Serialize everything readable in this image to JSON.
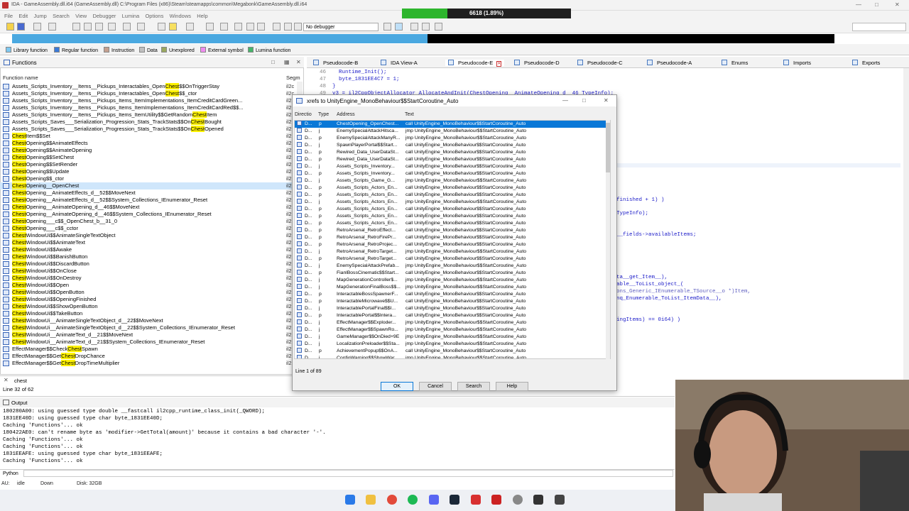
{
  "window": {
    "title": "IDA - GameAssembly.dll.i64 (GameAssembly.dll) C:\\Program Files (x86)\\Steam\\steamapps\\common\\Megabonk\\GameAssembly.dll.i64",
    "progress_text": "6618 (1.89%)",
    "progress_fraction": 0.27
  },
  "menu": [
    "File",
    "Edit",
    "Jump",
    "Search",
    "View",
    "Debugger",
    "Lumina",
    "Options",
    "Windows",
    "Help"
  ],
  "toolbar": {
    "debugger_select": "No debugger"
  },
  "legend": [
    {
      "label": "Library function",
      "color": "#7ec8f0"
    },
    {
      "label": "Regular function",
      "color": "#3a7ad8"
    },
    {
      "label": "Instruction",
      "color": "#c4a090"
    },
    {
      "label": "Data",
      "color": "#c0c0c0"
    },
    {
      "label": "Unexplored",
      "color": "#9aa860"
    },
    {
      "label": "External symbol",
      "color": "#f08cf0"
    },
    {
      "label": "Lumina function",
      "color": "#46b46a"
    }
  ],
  "functions": {
    "title": "Functions",
    "col_name": "Function name",
    "col_seg": "Segm",
    "rows": [
      {
        "pre": "Assets_Scripts_Inventory__Items__Pickups_Interactables_Open",
        "hl": "Chest",
        "post": "$$OnTriggerStay",
        "seg": "il2c"
      },
      {
        "pre": "Assets_Scripts_Inventory__Items__Pickups_Interactables_Open",
        "hl": "Chest",
        "post": "$$_ctor",
        "seg": "il2c"
      },
      {
        "pre": "Assets_Scripts_Inventory__Items__Pickups_Items_ItemImplementations_ItemCreditCardGreen...",
        "hl": "",
        "post": "",
        "seg": "il2"
      },
      {
        "pre": "Assets_Scripts_Inventory__Items__Pickups_Items_ItemImplementations_ItemCreditCardRed$$...",
        "hl": "",
        "post": "",
        "seg": "il2"
      },
      {
        "pre": "Assets_Scripts_Inventory__Items__Pickups_Items_ItemUtility$$GetRandom",
        "hl": "Chest",
        "post": "Item",
        "seg": "il2"
      },
      {
        "pre": "Assets_Scripts_Saves___Serialization_Progression_Stats_TrackStats$$On",
        "hl": "Chest",
        "post": "Bought",
        "seg": "il2"
      },
      {
        "pre": "Assets_Scripts_Saves___Serialization_Progression_Stats_TrackStats$$On",
        "hl": "Chest",
        "post": "Opened",
        "seg": "il2"
      },
      {
        "pre": "",
        "hl": "Chest",
        "post": "Item$$Set",
        "seg": "il2"
      },
      {
        "pre": "",
        "hl": "Chest",
        "post": "Opening$$AnimateEffects",
        "seg": "il2"
      },
      {
        "pre": "",
        "hl": "Chest",
        "post": "Opening$$AnimateOpening",
        "seg": "il2"
      },
      {
        "pre": "",
        "hl": "Chest",
        "post": "Opening$$SetChest",
        "seg": "il2"
      },
      {
        "pre": "",
        "hl": "Chest",
        "post": "Opening$$SetRender",
        "seg": "il2"
      },
      {
        "pre": "",
        "hl": "Chest",
        "post": "Opening$$Update",
        "seg": "il2"
      },
      {
        "pre": "",
        "hl": "Chest",
        "post": "Opening$$_ctor",
        "seg": "il2"
      },
      {
        "pre": "",
        "hl": "Chest",
        "post": "Opening__OpenChest",
        "seg": "il2"
      },
      {
        "pre": "",
        "hl": "Chest",
        "post": "Opening__AnimateEffects_d__52$$MoveNext",
        "seg": "il2"
      },
      {
        "pre": "",
        "hl": "Chest",
        "post": "Opening__AnimateEffects_d__52$$System_Collections_IEnumerator_Reset",
        "seg": "il2"
      },
      {
        "pre": "",
        "hl": "Chest",
        "post": "Opening__AnimateOpening_d__46$$MoveNext",
        "seg": "il2"
      },
      {
        "pre": "",
        "hl": "Chest",
        "post": "Opening__AnimateOpening_d__46$$System_Collections_IEnumerator_Reset",
        "seg": "il2"
      },
      {
        "pre": "",
        "hl": "Chest",
        "post": "Opening___c$$_OpenChest_b__31_0",
        "seg": "il2"
      },
      {
        "pre": "",
        "hl": "Chest",
        "post": "Opening___c$$_cctor",
        "seg": "il2"
      },
      {
        "pre": "",
        "hl": "Chest",
        "post": "WindowUi$$AnimateSingleTextObject",
        "seg": "il2"
      },
      {
        "pre": "",
        "hl": "Chest",
        "post": "WindowUi$$AnimateText",
        "seg": "il2"
      },
      {
        "pre": "",
        "hl": "Chest",
        "post": "WindowUi$$Awake",
        "seg": "il2"
      },
      {
        "pre": "",
        "hl": "Chest",
        "post": "WindowUi$$BanishButton",
        "seg": "il2"
      },
      {
        "pre": "",
        "hl": "Chest",
        "post": "WindowUi$$DiscardButton",
        "seg": "il2"
      },
      {
        "pre": "",
        "hl": "Chest",
        "post": "WindowUi$$OnClose",
        "seg": "il2"
      },
      {
        "pre": "",
        "hl": "Chest",
        "post": "WindowUi$$OnDestroy",
        "seg": "il2"
      },
      {
        "pre": "",
        "hl": "Chest",
        "post": "WindowUi$$Open",
        "seg": "il2"
      },
      {
        "pre": "",
        "hl": "Chest",
        "post": "WindowUi$$OpenButton",
        "seg": "il2"
      },
      {
        "pre": "",
        "hl": "Chest",
        "post": "WindowUi$$OpeningFinished",
        "seg": "il2"
      },
      {
        "pre": "",
        "hl": "Chest",
        "post": "WindowUi$$ShowOpenButton",
        "seg": "il2"
      },
      {
        "pre": "",
        "hl": "Chest",
        "post": "WindowUi$$TakeButton",
        "seg": "il2"
      },
      {
        "pre": "",
        "hl": "Chest",
        "post": "WindowUi__AnimateSingleTextObject_d__22$$MoveNext",
        "seg": "il2"
      },
      {
        "pre": "",
        "hl": "Chest",
        "post": "WindowUi__AnimateSingleTextObject_d__22$$System_Collections_IEnumerator_Reset",
        "seg": "il2"
      },
      {
        "pre": "",
        "hl": "Chest",
        "post": "WindowUi__AnimateText_d__21$$MoveNext",
        "seg": "il2"
      },
      {
        "pre": "",
        "hl": "Chest",
        "post": "WindowUi__AnimateText_d__21$$System_Collections_IEnumerator_Reset",
        "seg": "il2"
      },
      {
        "pre": "EffectManager$$Check",
        "hl": "Chest",
        "post": "Spawn",
        "seg": "il2"
      },
      {
        "pre": "EffectManager$$Get",
        "hl": "Chest",
        "post": "DropChance",
        "seg": "il2"
      },
      {
        "pre": "EffectManager$$Get",
        "hl": "Chest",
        "post": "DropTimeMultiplier",
        "seg": "il2"
      }
    ],
    "selected_index": 14,
    "search_value": "chest",
    "line_info": "Line 32 of 62"
  },
  "tabs": [
    {
      "label": "Pseudocode-B",
      "active": false
    },
    {
      "label": "IDA View-A",
      "active": false
    },
    {
      "label": "Pseudocode-E",
      "active": true
    },
    {
      "label": "Pseudocode-D",
      "active": false
    },
    {
      "label": "Pseudocode-C",
      "active": false
    },
    {
      "label": "Pseudocode-A",
      "active": false
    },
    {
      "label": "Enums",
      "active": false
    },
    {
      "label": "Imports",
      "active": false
    },
    {
      "label": "Exports",
      "active": false
    }
  ],
  "code": {
    "lines": [
      {
        "n": "46",
        "t": "    Runtime_Init();"
      },
      {
        "n": "47",
        "t": "    byte_1831EE4C7 = 1;"
      },
      {
        "n": "48",
        "t": "  }"
      },
      {
        "n": "49",
        "t": "  v3 = il2CppObjectAllocator_AllocateAndInit(ChestOpening__AnimateOpening_d__46_TypeInfo);"
      }
    ],
    "fragments": [
      "finished + 1) )",
      "TypeInfo);",
      "__fields->availableItems;",
      "ta__get_Item__),",
      "able__ToList_object_(",
      "ons_Generic_IEnumerable_TSource__o *)Item,",
      "nq_Enumerable_ToList_ItemData__),",
      "ingItems) == 0i64) )"
    ]
  },
  "xrefs": {
    "title": "xrefs to UnityEngine_MonoBehaviour$$StartCoroutine_Auto",
    "headers": {
      "dir": "Directio",
      "type": "Type",
      "addr": "Address",
      "text": "Text"
    },
    "rows": [
      {
        "d": "D...",
        "t": "p",
        "a": "ChestOpening_OpenChest...",
        "x": "call   UnityEngine_MonoBehaviour$$StartCoroutine_Auto"
      },
      {
        "d": "D...",
        "t": "j",
        "a": "EnemySpecialAttackHitsca...",
        "x": "jmp    UnityEngine_MonoBehaviour$$StartCoroutine_Auto"
      },
      {
        "d": "D...",
        "t": "p",
        "a": "EnemySpecialAttackManyR...",
        "x": "jmp    UnityEngine_MonoBehaviour$$StartCoroutine_Auto"
      },
      {
        "d": "D...",
        "t": "j",
        "a": "SpawnPlayerPortal$$Start...",
        "x": "call   UnityEngine_MonoBehaviour$$StartCoroutine_Auto"
      },
      {
        "d": "D...",
        "t": "p",
        "a": "Rewired_Data_UserDataSt...",
        "x": "call   UnityEngine_MonoBehaviour$$StartCoroutine_Auto"
      },
      {
        "d": "D...",
        "t": "p",
        "a": "Rewired_Data_UserDataSt...",
        "x": "call   UnityEngine_MonoBehaviour$$StartCoroutine_Auto"
      },
      {
        "d": "D...",
        "t": "j",
        "a": "Assets_Scripts_Inventory...",
        "x": "call   UnityEngine_MonoBehaviour$$StartCoroutine_Auto"
      },
      {
        "d": "D...",
        "t": "p",
        "a": "Assets_Scripts_Inventory...",
        "x": "call   UnityEngine_MonoBehaviour$$StartCoroutine_Auto"
      },
      {
        "d": "D...",
        "t": "j",
        "a": "Assets_Scripts_Game_G...",
        "x": "jmp    UnityEngine_MonoBehaviour$$StartCoroutine_Auto"
      },
      {
        "d": "D...",
        "t": "p",
        "a": "Assets_Scripts_Actors_En...",
        "x": "call   UnityEngine_MonoBehaviour$$StartCoroutine_Auto"
      },
      {
        "d": "D...",
        "t": "p",
        "a": "Assets_Scripts_Actors_En...",
        "x": "call   UnityEngine_MonoBehaviour$$StartCoroutine_Auto"
      },
      {
        "d": "D...",
        "t": "j",
        "a": "Assets_Scripts_Actors_En...",
        "x": "jmp    UnityEngine_MonoBehaviour$$StartCoroutine_Auto"
      },
      {
        "d": "D...",
        "t": "p",
        "a": "Assets_Scripts_Actors_En...",
        "x": "call   UnityEngine_MonoBehaviour$$StartCoroutine_Auto"
      },
      {
        "d": "D...",
        "t": "p",
        "a": "Assets_Scripts_Actors_En...",
        "x": "call   UnityEngine_MonoBehaviour$$StartCoroutine_Auto"
      },
      {
        "d": "D...",
        "t": "p",
        "a": "Assets_Scripts_Actors_En...",
        "x": "call   UnityEngine_MonoBehaviour$$StartCoroutine_Auto"
      },
      {
        "d": "D...",
        "t": "p",
        "a": "RetroArsenal_RetroEffect...",
        "x": "call   UnityEngine_MonoBehaviour$$StartCoroutine_Auto"
      },
      {
        "d": "D...",
        "t": "p",
        "a": "RetroArsenal_RetroFirePr...",
        "x": "call   UnityEngine_MonoBehaviour$$StartCoroutine_Auto"
      },
      {
        "d": "D...",
        "t": "p",
        "a": "RetroArsenal_RetroProjec...",
        "x": "call   UnityEngine_MonoBehaviour$$StartCoroutine_Auto"
      },
      {
        "d": "D...",
        "t": "j",
        "a": "RetroArsenal_RetroTarget...",
        "x": "jmp    UnityEngine_MonoBehaviour$$StartCoroutine_Auto"
      },
      {
        "d": "D...",
        "t": "p",
        "a": "RetroArsenal_RetroTarget...",
        "x": "call   UnityEngine_MonoBehaviour$$StartCoroutine_Auto"
      },
      {
        "d": "D...",
        "t": "j",
        "a": "EnemySpecialAttackPrefab...",
        "x": "jmp    UnityEngine_MonoBehaviour$$StartCoroutine_Auto"
      },
      {
        "d": "D...",
        "t": "p",
        "a": "FianlBossCinematic$$Start...",
        "x": "call   UnityEngine_MonoBehaviour$$StartCoroutine_Auto"
      },
      {
        "d": "D...",
        "t": "j",
        "a": "MapGenerationController$...",
        "x": "jmp    UnityEngine_MonoBehaviour$$StartCoroutine_Auto"
      },
      {
        "d": "D...",
        "t": "j",
        "a": "MapGenerationFinalBoss$$...",
        "x": "jmp    UnityEngine_MonoBehaviour$$StartCoroutine_Auto"
      },
      {
        "d": "D...",
        "t": "p",
        "a": "InteractableBossSpawnerF...",
        "x": "call   UnityEngine_MonoBehaviour$$StartCoroutine_Auto"
      },
      {
        "d": "D...",
        "t": "p",
        "a": "InteractableMicrowave$$U...",
        "x": "call   UnityEngine_MonoBehaviour$$StartCoroutine_Auto"
      },
      {
        "d": "D...",
        "t": "j",
        "a": "InteractablePortalFinal$$I...",
        "x": "call   UnityEngine_MonoBehaviour$$StartCoroutine_Auto"
      },
      {
        "d": "D...",
        "t": "p",
        "a": "InteractablePortal$$Intera...",
        "x": "call   UnityEngine_MonoBehaviour$$StartCoroutine_Auto"
      },
      {
        "d": "D...",
        "t": "j",
        "a": "EffectManager$$Exploder...",
        "x": "jmp    UnityEngine_MonoBehaviour$$StartCoroutine_Auto"
      },
      {
        "d": "D...",
        "t": "j",
        "a": "EffectManager$$SpawnRo...",
        "x": "jmp    UnityEngine_MonoBehaviour$$StartCoroutine_Auto"
      },
      {
        "d": "D...",
        "t": "j",
        "a": "GameManager$$OnDied+9E",
        "x": "jmp    UnityEngine_MonoBehaviour$$StartCoroutine_Auto"
      },
      {
        "d": "D...",
        "t": "j",
        "a": "LocalizationPreloader$$Sta...",
        "x": "jmp    UnityEngine_MonoBehaviour$$StartCoroutine_Auto"
      },
      {
        "d": "D...",
        "t": "p",
        "a": "AchievementPopup$$OnA...",
        "x": "call   UnityEngine_MonoBehaviour$$StartCoroutine_Auto"
      },
      {
        "d": "D...",
        "t": "j",
        "a": "ConfigWarning$$ShowWar...",
        "x": "jmp    UnityEngine_MonoBehaviour$$StartCoroutine_Auto"
      }
    ],
    "footer": "Line 1 of 89",
    "buttons": {
      "ok": "OK",
      "cancel": "Cancel",
      "search": "Search",
      "help": "Help"
    }
  },
  "output": {
    "title": "Output",
    "lines": [
      "180280A00: using guessed type double __fastcall il2cpp_runtime_class_init(_QWORD);",
      "1831EE40D: using guessed type char byte_1831EE40D;",
      "Caching 'Functions'... ok",
      "180422AE0: can't rename byte as 'modifier->GetTotal(amount)' because it contains a bad character '-'.",
      "Caching 'Functions'... ok",
      "Caching 'Functions'... ok",
      "1831EEAFE: using guessed type char byte_1831EEAFE;",
      "Caching 'Functions'... ok"
    ],
    "lang": "Python"
  },
  "status": {
    "au": "AU:",
    "state": "idle",
    "dir": "Down",
    "disk": "Disk: 32GB"
  }
}
